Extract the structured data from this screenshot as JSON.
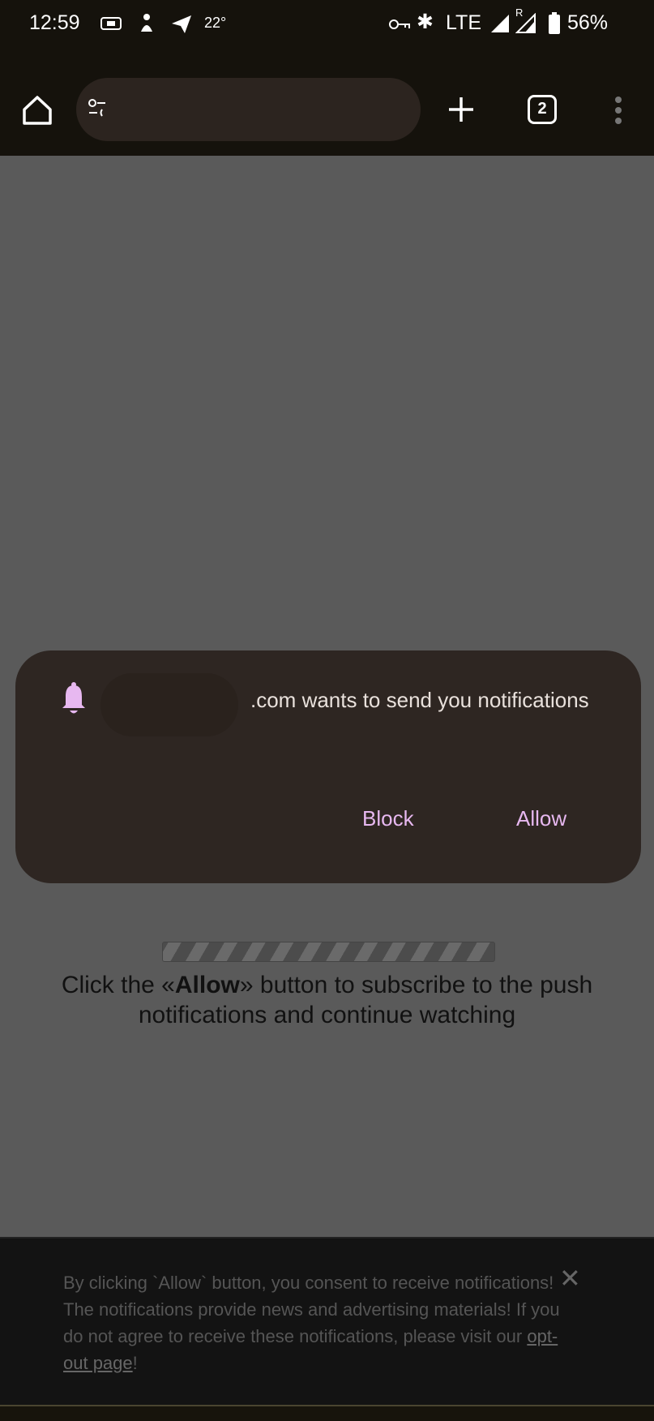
{
  "status_bar": {
    "time": "12:59",
    "temperature": "22°",
    "network": "LTE",
    "roaming": "R",
    "battery": "56%"
  },
  "toolbar": {
    "tab_count": "2",
    "url": ""
  },
  "dialog": {
    "message": ".com wants to send you notifications",
    "block_label": "Block",
    "allow_label": "Allow",
    "accent": "#e7b8f0"
  },
  "page": {
    "msg_before": "Click the «",
    "msg_bold": "Allow",
    "msg_after": "» button to subscribe to the push notifications and continue watching"
  },
  "banner": {
    "text": "By clicking `Allow` button, you consent to receive notifications! The notifications provide news and advertising materials! If you do not agree to receive these notifications, please visit our ",
    "link": "opt-out page",
    "end": "!",
    "close": "✕"
  }
}
